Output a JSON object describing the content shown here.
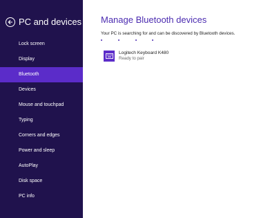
{
  "sidebar": {
    "title": "PC and devices",
    "back_icon": "back-arrow-icon",
    "background": "#20124d",
    "active_color": "#5b2cc9",
    "items": [
      {
        "label": "Lock screen",
        "active": false
      },
      {
        "label": "Display",
        "active": false
      },
      {
        "label": "Bluetooth",
        "active": true
      },
      {
        "label": "Devices",
        "active": false
      },
      {
        "label": "Mouse and touchpad",
        "active": false
      },
      {
        "label": "Typing",
        "active": false
      },
      {
        "label": "Corners and edges",
        "active": false
      },
      {
        "label": "Power and sleep",
        "active": false
      },
      {
        "label": "AutoPlay",
        "active": false
      },
      {
        "label": "Disk space",
        "active": false
      },
      {
        "label": "PC info",
        "active": false
      }
    ]
  },
  "main": {
    "title": "Manage Bluetooth devices",
    "title_color": "#4b2bb0",
    "status": "Your PC is searching for and can be discovered by Bluetooth devices.",
    "devices": [
      {
        "name": "Logitech Keyboard K480",
        "status": "Ready to pair",
        "icon": "keyboard-icon"
      }
    ]
  }
}
